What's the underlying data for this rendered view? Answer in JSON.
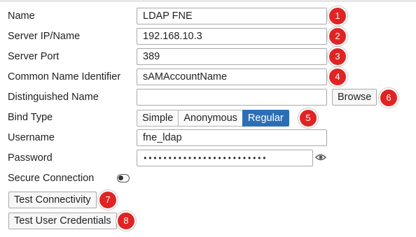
{
  "form": {
    "name": {
      "label": "Name",
      "value": "LDAP FNE"
    },
    "server": {
      "label": "Server IP/Name",
      "value": "192.168.10.3"
    },
    "port": {
      "label": "Server Port",
      "value": "389"
    },
    "cn": {
      "label": "Common Name Identifier",
      "value": "sAMAccountName"
    },
    "dn": {
      "label": "Distinguished Name",
      "value": "",
      "browse_label": "Browse"
    },
    "bind": {
      "label": "Bind Type",
      "options": [
        "Simple",
        "Anonymous",
        "Regular"
      ],
      "selected": "Regular"
    },
    "username": {
      "label": "Username",
      "value": "fne_ldap"
    },
    "password": {
      "label": "Password",
      "value": "•••••••••••••••••••••••••"
    },
    "secure": {
      "label": "Secure Connection",
      "enabled": false
    },
    "test_connectivity_label": "Test Connectivity",
    "test_credentials_label": "Test User Credentials"
  },
  "callouts": [
    "1",
    "2",
    "3",
    "4",
    "5",
    "6",
    "7",
    "8"
  ],
  "colors": {
    "callout": "#e02424",
    "accent": "#2c6eb5"
  },
  "icons": {
    "password_reveal": "eye-icon",
    "secure_toggle": "toggle-switch"
  }
}
